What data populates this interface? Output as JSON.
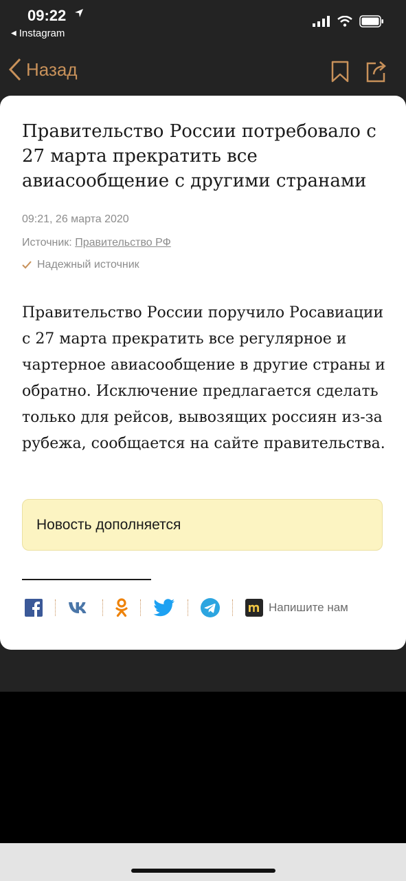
{
  "status": {
    "time": "09:22",
    "back_app": "Instagram"
  },
  "nav": {
    "back_label": "Назад"
  },
  "article": {
    "title": "Правительство России потребовало с 27 марта прекратить все авиасообщение с другими странами",
    "date": "09:21, 26 марта 2020",
    "source_label": "Источник:",
    "source_link": "Правительство РФ",
    "reliable": "Надежный источник",
    "body": "Правительство России поручило Росавиации с 27 марта прекратить все регулярное и чартерное авиасообщение в другие страны и обратно. Исключение предлагается сделать только для рейсов, вывозящих россиян из-за рубежа, сообщается на сайте правительства.",
    "notice": "Новость дополняется"
  },
  "share": {
    "icons": [
      "facebook-icon",
      "vk-icon",
      "odnoklassniki-icon",
      "twitter-icon",
      "telegram-icon",
      "meduza-icon"
    ],
    "write_us": "Напишите нам"
  },
  "colors": {
    "accent": "#c8915a",
    "header_bg": "#232323",
    "notice_bg": "#fcf4c2"
  }
}
